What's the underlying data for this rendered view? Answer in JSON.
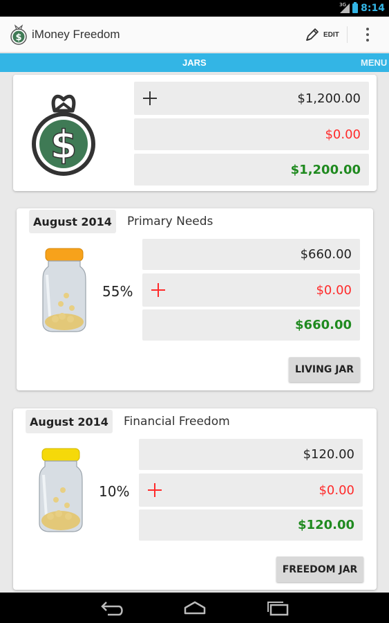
{
  "status_bar": {
    "signal_label": "3G",
    "time": "8:14"
  },
  "action_bar": {
    "title": "iMoney Freedom",
    "edit_label": "EDIT"
  },
  "tabs": {
    "active": "JARS",
    "next": "MENU"
  },
  "summary": {
    "income": "$1,200.00",
    "spent": "$0.00",
    "balance": "$1,200.00"
  },
  "jars": [
    {
      "date": "August 2014",
      "name": "Primary Needs",
      "percent": "55%",
      "allocated": "$660.00",
      "spent": "$0.00",
      "balance": "$660.00",
      "button": "LIVING JAR",
      "lid_color": "#f7a21b"
    },
    {
      "date": "August 2014",
      "name": "Financial Freedom",
      "percent": "10%",
      "allocated": "$120.00",
      "spent": "$0.00",
      "balance": "$120.00",
      "button": "FREEDOM JAR",
      "lid_color": "#f5d90a"
    }
  ],
  "colors": {
    "accent": "#33b5e5",
    "negative": "#ff2a2a",
    "positive": "#1f8a1f",
    "moneybag": "#3f7a55"
  },
  "icons": [
    "money-bag-icon",
    "pencil-icon",
    "overflow-menu-icon",
    "plus-icon",
    "jar-icon",
    "back-icon",
    "home-icon",
    "recent-apps-icon"
  ]
}
